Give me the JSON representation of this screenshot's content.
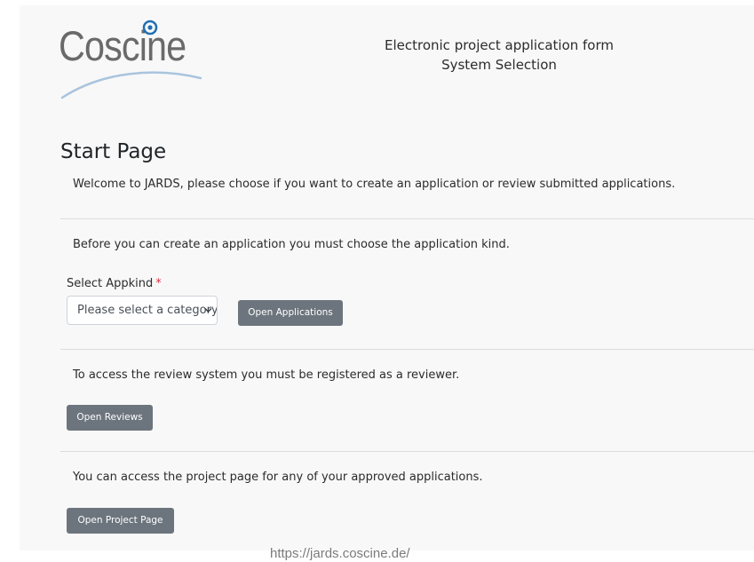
{
  "header": {
    "logo_text": "Coscine",
    "title_line1": "Electronic project application form",
    "title_line2": "System Selection"
  },
  "start": {
    "title": "Start Page",
    "welcome": "Welcome to JARDS, please choose if you want to create an application or review submitted applications."
  },
  "applications": {
    "intro": "Before you can create an application you must choose the application kind.",
    "select_label": "Select Appkind",
    "required_mark": "*",
    "select_value": "Please select a category",
    "open_button": "Open Applications"
  },
  "reviews": {
    "intro": "To access the review system you must be registered as a reviewer.",
    "open_button": "Open Reviews"
  },
  "projects": {
    "intro": "You can access the project page for any of your approved applications.",
    "open_button": "Open Project Page"
  },
  "footer": {
    "url": "https://jards.coscine.de/"
  },
  "colors": {
    "button": "#6c757d",
    "logo_accent": "#1f6fb2",
    "required": "#dc3545"
  }
}
